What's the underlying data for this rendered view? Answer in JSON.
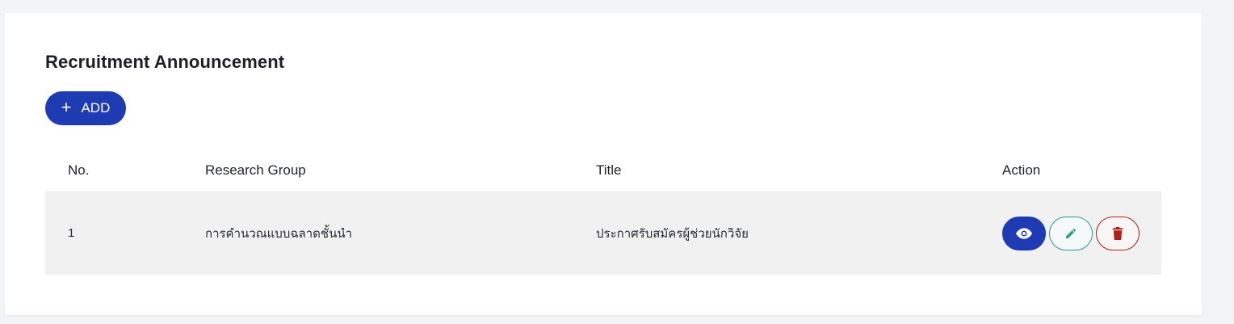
{
  "page": {
    "title": "Recruitment Announcement",
    "add_label": "ADD"
  },
  "table": {
    "headers": {
      "no": "No.",
      "group": "Research Group",
      "title": "Title",
      "action": "Action"
    },
    "rows": [
      {
        "no": "1",
        "group": "การคำนวณแบบฉลาดชั้นนำ",
        "title": "ประกาศรับสมัครผู้ช่วยนักวิจัย"
      }
    ]
  },
  "icons": {
    "view": "eye-icon",
    "edit": "pencil-icon",
    "delete": "trash-icon"
  },
  "colors": {
    "primary": "#1e3bb3",
    "edit": "#2a9d8f",
    "delete": "#b02018",
    "row_bg": "#f1f1f2"
  }
}
